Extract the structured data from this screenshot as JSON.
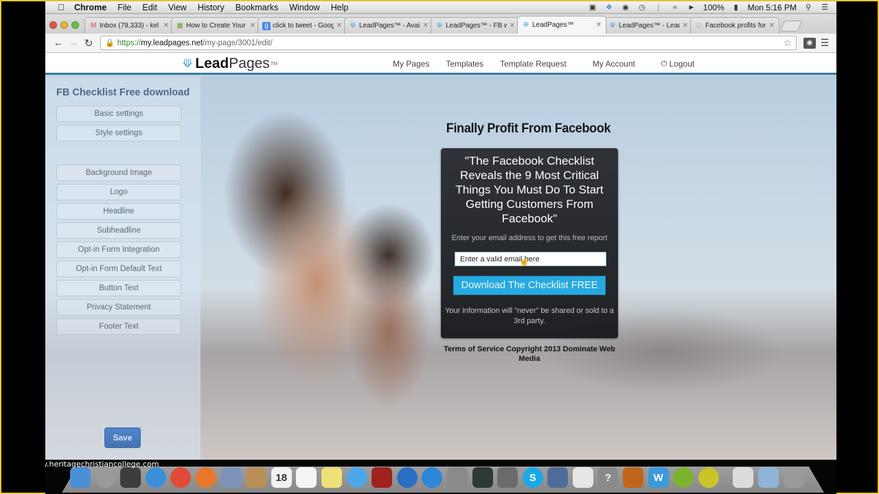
{
  "menubar": {
    "app_name": "Chrome",
    "items": [
      "File",
      "Edit",
      "View",
      "History",
      "Bookmarks",
      "Window",
      "Help"
    ],
    "battery": "100%",
    "clock": "Mon 5:16 PM"
  },
  "browser": {
    "tabs": [
      {
        "title": "Inbox (79,333) - kel",
        "icon": "gmail-icon",
        "active": false
      },
      {
        "title": "How to Create Your",
        "icon": "page-icon",
        "active": false
      },
      {
        "title": "click to tweet - Goog",
        "icon": "google-docs-icon",
        "active": false
      },
      {
        "title": "LeadPages™ - Availa",
        "icon": "leadpages-icon",
        "active": false
      },
      {
        "title": "LeadPages™ - FB we",
        "icon": "leadpages-icon",
        "active": false
      },
      {
        "title": "LeadPages™",
        "icon": "leadpages-icon",
        "active": true
      },
      {
        "title": "LeadPages™ - LeadP",
        "icon": "leadpages-icon",
        "active": false
      },
      {
        "title": "Facebook profits for",
        "icon": "document-icon",
        "active": false
      }
    ],
    "url": {
      "scheme": "https://",
      "host": "my.leadpages.net",
      "path": "/my-page/3001/edit/"
    }
  },
  "leadpages": {
    "logo": {
      "bold": "Lead",
      "light": "Pages",
      "tm": "TM"
    },
    "nav": [
      "My Pages",
      "Templates",
      "Template Request",
      "My Account",
      "Logout"
    ]
  },
  "editor": {
    "title": "FB Checklist Free download",
    "buttons": [
      "Basic settings",
      "Style settings",
      "Background Image",
      "Logo",
      "Headline",
      "Subheadline",
      "Opt-in Form Integration",
      "Opt-in Form Default Text",
      "Button Text",
      "Privacy Statement",
      "Footer Text"
    ],
    "save_label": "Save"
  },
  "landing": {
    "headline": "Finally Profit From Facebook",
    "subheadline": "\"The Facebook Checklist Reveals the 9 Most Critical Things You Must Do To Start Getting Customers From Facebook\"",
    "email_label": "Enter your email address to get this free report",
    "email_value": "Enter a valid email here",
    "cta": "Download The Checklist FREE",
    "privacy": "Your information will \"never\" be shared or sold to a 3rd party.",
    "footer": "Terms of Service Copyright 2013 Dominate Web Media"
  },
  "dock": {
    "apps": [
      {
        "name": "finder",
        "color": "#4a8fd8"
      },
      {
        "name": "launchpad",
        "color": "#9a9a9a"
      },
      {
        "name": "dashboard",
        "color": "#3d3d3d"
      },
      {
        "name": "safari",
        "color": "#3a90d8"
      },
      {
        "name": "chrome",
        "color": "#e14b3b"
      },
      {
        "name": "firefox",
        "color": "#e7782b"
      },
      {
        "name": "mail",
        "color": "#7d94b8"
      },
      {
        "name": "contacts",
        "color": "#b9905a"
      },
      {
        "name": "calendar",
        "color": "#f2f2f2",
        "label": "18"
      },
      {
        "name": "reminders",
        "color": "#f5f5f5"
      },
      {
        "name": "notes",
        "color": "#efe17a"
      },
      {
        "name": "messages",
        "color": "#4ea7ea"
      },
      {
        "name": "photo-booth",
        "color": "#a0221e"
      },
      {
        "name": "itunes",
        "color": "#2a6fc4"
      },
      {
        "name": "app-store",
        "color": "#2d86d8"
      },
      {
        "name": "system-preferences",
        "color": "#8a8a8a"
      },
      {
        "name": "activity-monitor",
        "color": "#2b3a32"
      },
      {
        "name": "knight-app",
        "color": "#6b6b6b"
      },
      {
        "name": "skype",
        "color": "#1aa9e6",
        "label": "S"
      },
      {
        "name": "imovie",
        "color": "#4d6c9a"
      },
      {
        "name": "text-edit",
        "color": "#e6e6e6"
      },
      {
        "name": "help",
        "color": "#8a8a8a",
        "label": "?"
      },
      {
        "name": "keynote",
        "color": "#c1651c"
      },
      {
        "name": "word",
        "color": "#3b9ad9",
        "label": "W"
      },
      {
        "name": "clock-app",
        "color": "#7bb32e"
      },
      {
        "name": "audio-app",
        "color": "#c8c42a"
      },
      {
        "name": "document",
        "color": "#dcdcdc"
      },
      {
        "name": "folder",
        "color": "#8fb4d8"
      },
      {
        "name": "trash",
        "color": "#9a9a9a"
      }
    ]
  },
  "watermark": "www.heritagechristiancollege.com"
}
